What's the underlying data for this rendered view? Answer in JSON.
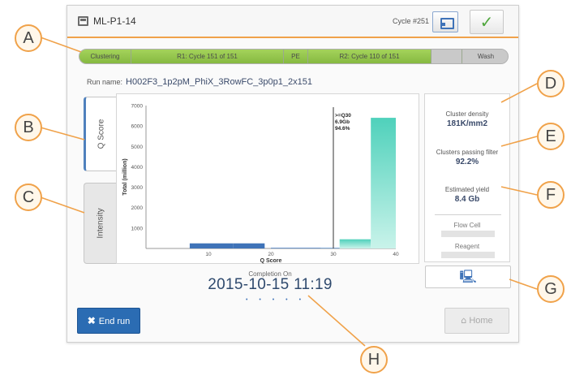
{
  "header": {
    "title": "ML-P1-14",
    "cycle": "Cycle #251"
  },
  "progress": {
    "segments": [
      {
        "label": "Clustering"
      },
      {
        "label": "R1: Cycle 151 of 151"
      },
      {
        "label": "PE"
      },
      {
        "label": "R2: Cycle 110 of 151"
      },
      {
        "label": ""
      },
      {
        "label": "Wash"
      }
    ]
  },
  "run": {
    "label": "Run name:",
    "value": "H002F3_1p2pM_PhiX_3RowFC_3p0p1_2x151"
  },
  "tabs": {
    "qscore": "Q Score",
    "intensity": "Intensity"
  },
  "chart_data": {
    "type": "bar",
    "xlabel": "Q Score",
    "ylabel": "Total (million)",
    "xlim": [
      0,
      40
    ],
    "ylim": [
      0,
      7000
    ],
    "xticks": [
      10,
      20,
      30,
      40
    ],
    "yticks": [
      1000,
      2000,
      3000,
      4000,
      5000,
      6000,
      7000
    ],
    "bars": [
      {
        "x0": 7,
        "x1": 14,
        "value": 250,
        "color": "#3f73b8"
      },
      {
        "x0": 14,
        "x1": 19,
        "value": 250,
        "color": "#3f73b8"
      },
      {
        "x0": 20,
        "x1": 28,
        "value": 40,
        "color": "#6c96cc"
      },
      {
        "x0": 28,
        "x1": 31,
        "value": 40,
        "color": "#7fa9d8"
      },
      {
        "x0": 31,
        "x1": 36,
        "value": 450,
        "color": "#5fd6c2"
      },
      {
        "x0": 36,
        "x1": 40,
        "value": 6400,
        "color": "#5fd6c2"
      }
    ],
    "threshold": {
      "x": 30,
      "label": ">=Q30",
      "yield": "6.9Gb",
      "percent": "94.6%"
    }
  },
  "metrics": {
    "cluster_density_label": "Cluster density",
    "cluster_density_value": "181K/mm2",
    "passing_filter_label": "Clusters passing filter",
    "passing_filter_value": "92.2%",
    "yield_label": "Estimated yield",
    "yield_value": "8.4 Gb",
    "flow_cell_label": "Flow Cell",
    "reagent_label": "Reagent"
  },
  "completion": {
    "label": "Completion On",
    "value": "2015-10-15  11:19",
    "dots": "• • • • •"
  },
  "buttons": {
    "end_run": "End run",
    "home": "Home"
  },
  "callouts": [
    "A",
    "B",
    "C",
    "D",
    "E",
    "F",
    "G",
    "H"
  ],
  "colors": {
    "accent": "#f0a24a",
    "primary_blue": "#2b6cb3",
    "progress_green": "#96c84d",
    "bar_teal": "#5fd6c2"
  }
}
